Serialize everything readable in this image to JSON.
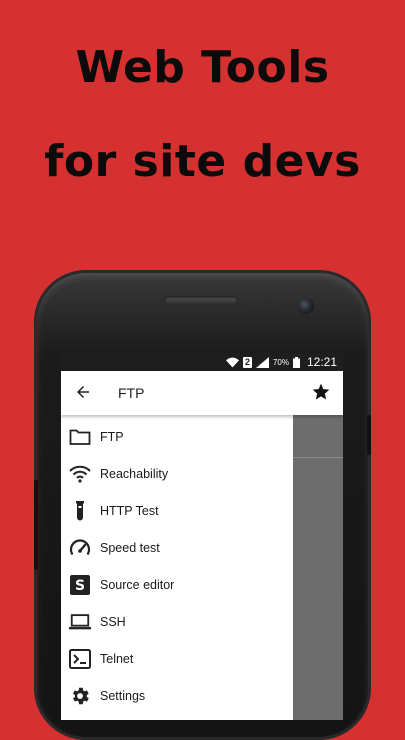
{
  "headline": {
    "line1": "Web Tools",
    "line2": "for site devs"
  },
  "statusbar": {
    "sim": "2",
    "battery": "70%",
    "time": "12:21"
  },
  "appbar": {
    "title": "FTP",
    "back_icon": "arrow-back-icon",
    "action_icon": "star-icon"
  },
  "drawer": {
    "items": [
      {
        "label": "FTP",
        "icon": "folder-icon"
      },
      {
        "label": "Reachability",
        "icon": "wifi-icon"
      },
      {
        "label": "HTTP Test",
        "icon": "test-tube-icon"
      },
      {
        "label": "Speed test",
        "icon": "speedometer-icon"
      },
      {
        "label": "Source editor",
        "icon": "s-badge-icon"
      },
      {
        "label": "SSH",
        "icon": "laptop-icon"
      },
      {
        "label": "Telnet",
        "icon": "terminal-icon"
      },
      {
        "label": "Settings",
        "icon": "gear-icon"
      }
    ]
  },
  "colors": {
    "background": "#d63131",
    "headline": "#0b0b0b",
    "drawer": "#ffffff",
    "scrim": "#6b6b6b"
  }
}
